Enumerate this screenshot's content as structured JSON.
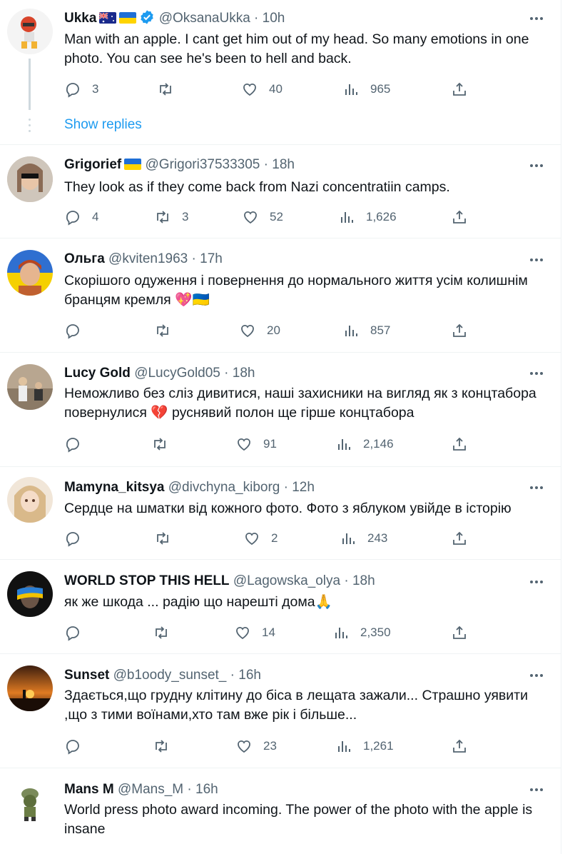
{
  "colors": {
    "link": "#1d9bf0",
    "secondary": "#536471",
    "text": "#0f1419"
  },
  "show_replies": "Show replies",
  "tweets": [
    {
      "name": "Ukka",
      "handle": "@OksanaUkka",
      "time": "10h",
      "flags": [
        "au",
        "ua"
      ],
      "verified": true,
      "text": "Man with an apple. I cant get him out of my head. So many emotions in one photo. You can see he's been to hell and back.",
      "replies": "3",
      "retweets": "",
      "likes": "40",
      "views": "965"
    },
    {
      "name": "Grigorief",
      "handle": "@Grigori37533305",
      "time": "18h",
      "flags": [
        "ua"
      ],
      "text": "They look as if they come back from Nazi concentratiin camps.",
      "replies": "4",
      "retweets": "3",
      "likes": "52",
      "views": "1,626"
    },
    {
      "name": "Ольга",
      "handle": "@kviten1963",
      "time": "17h",
      "flags": [],
      "text": "Скорішого одуження і повернення до нормального життя усім колишнім бранцям кремля 💖🇺🇦",
      "replies": "",
      "retweets": "",
      "likes": "20",
      "views": "857"
    },
    {
      "name": "Lucy Gold",
      "handle": "@LucyGold05",
      "time": "18h",
      "flags": [],
      "text": "Неможливо без сліз дивитися, наші захисники на вигляд як з концтабора повернулися 💔 руснявий полон ще гірше концтабора",
      "replies": "",
      "retweets": "",
      "likes": "91",
      "views": "2,146"
    },
    {
      "name": "Mamyna_kitsya",
      "handle": "@divchyna_kiborg",
      "time": "12h",
      "flags": [],
      "text": "Сердце на шматки від кожного фото. Фото з яблуком увійде в історію",
      "replies": "",
      "retweets": "",
      "likes": "2",
      "views": "243"
    },
    {
      "name": "WORLD STOP THIS HELL",
      "handle": "@Lagowska_olya",
      "time": "18h",
      "flags": [],
      "text": "як же шкода ... радію що нарешті дома🙏",
      "replies": "",
      "retweets": "",
      "likes": "14",
      "views": "2,350"
    },
    {
      "name": "Sunset",
      "handle": "@b1oody_sunset_",
      "time": "16h",
      "flags": [],
      "text": "Здається,що грудну клітину до біса в лещата зажали... Страшно уявити ,що з тими воїнами,хто там вже рік і більше...",
      "replies": "",
      "retweets": "",
      "likes": "23",
      "views": "1,261"
    },
    {
      "name": "Mans M",
      "handle": "@Mans_M",
      "time": "16h",
      "flags": [],
      "text": "World press photo award incoming. The power of the photo with the apple is insane",
      "replies": "",
      "retweets": "",
      "likes": "",
      "views": ""
    }
  ]
}
